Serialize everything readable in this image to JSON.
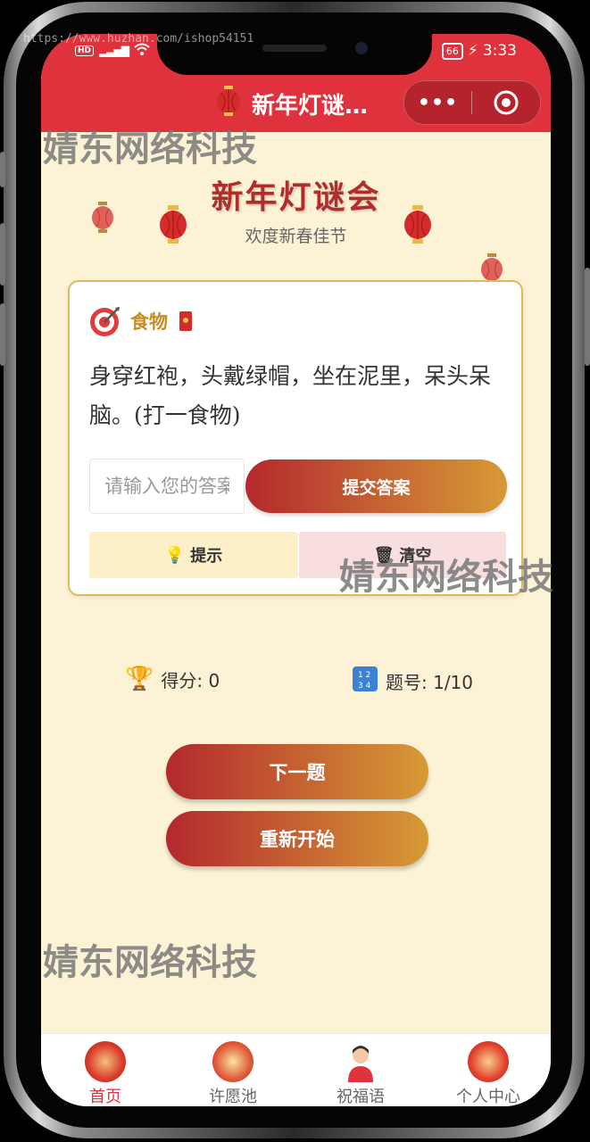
{
  "watermark": {
    "url": "https://www.huzhan.com/ishop54151",
    "company": "婧东网络科技"
  },
  "status_bar": {
    "hd": "HD",
    "signal": "4G",
    "battery": "66",
    "time": "3:33"
  },
  "nav": {
    "title": "新年灯谜…",
    "more_icon": "more-dots-icon",
    "close_icon": "target-circle-icon"
  },
  "header": {
    "title": "新年灯谜会",
    "subtitle": "欢度新春佳节"
  },
  "riddle_card": {
    "category_icon": "bullseye-icon",
    "category": "食物",
    "riddle": "身穿红袍，头戴绿帽，坐在泥里，呆头呆脑。(打一食物)",
    "input_placeholder": "请输入您的答案",
    "submit_label": "提交答案",
    "hint_label": "提示",
    "clear_label": "清空"
  },
  "stats": {
    "score": "得分: 0",
    "question": "题号: 1/10"
  },
  "actions": {
    "next_label": "下一题",
    "restart_label": "重新开始"
  },
  "tabbar": {
    "items": [
      {
        "label": "首页",
        "icon": "home-badge-icon",
        "active": true
      },
      {
        "label": "许愿池",
        "icon": "wish-pool-icon",
        "active": false
      },
      {
        "label": "祝福语",
        "icon": "person-avatar-icon",
        "active": false
      },
      {
        "label": "个人中心",
        "icon": "zhanji-badge-icon",
        "active": false
      }
    ]
  },
  "colors": {
    "brand_red": "#e0323d",
    "background": "#fcf3d7",
    "gradient_start": "#b3282d",
    "gradient_end": "#d69a35",
    "accent_gold": "#c98c21"
  }
}
